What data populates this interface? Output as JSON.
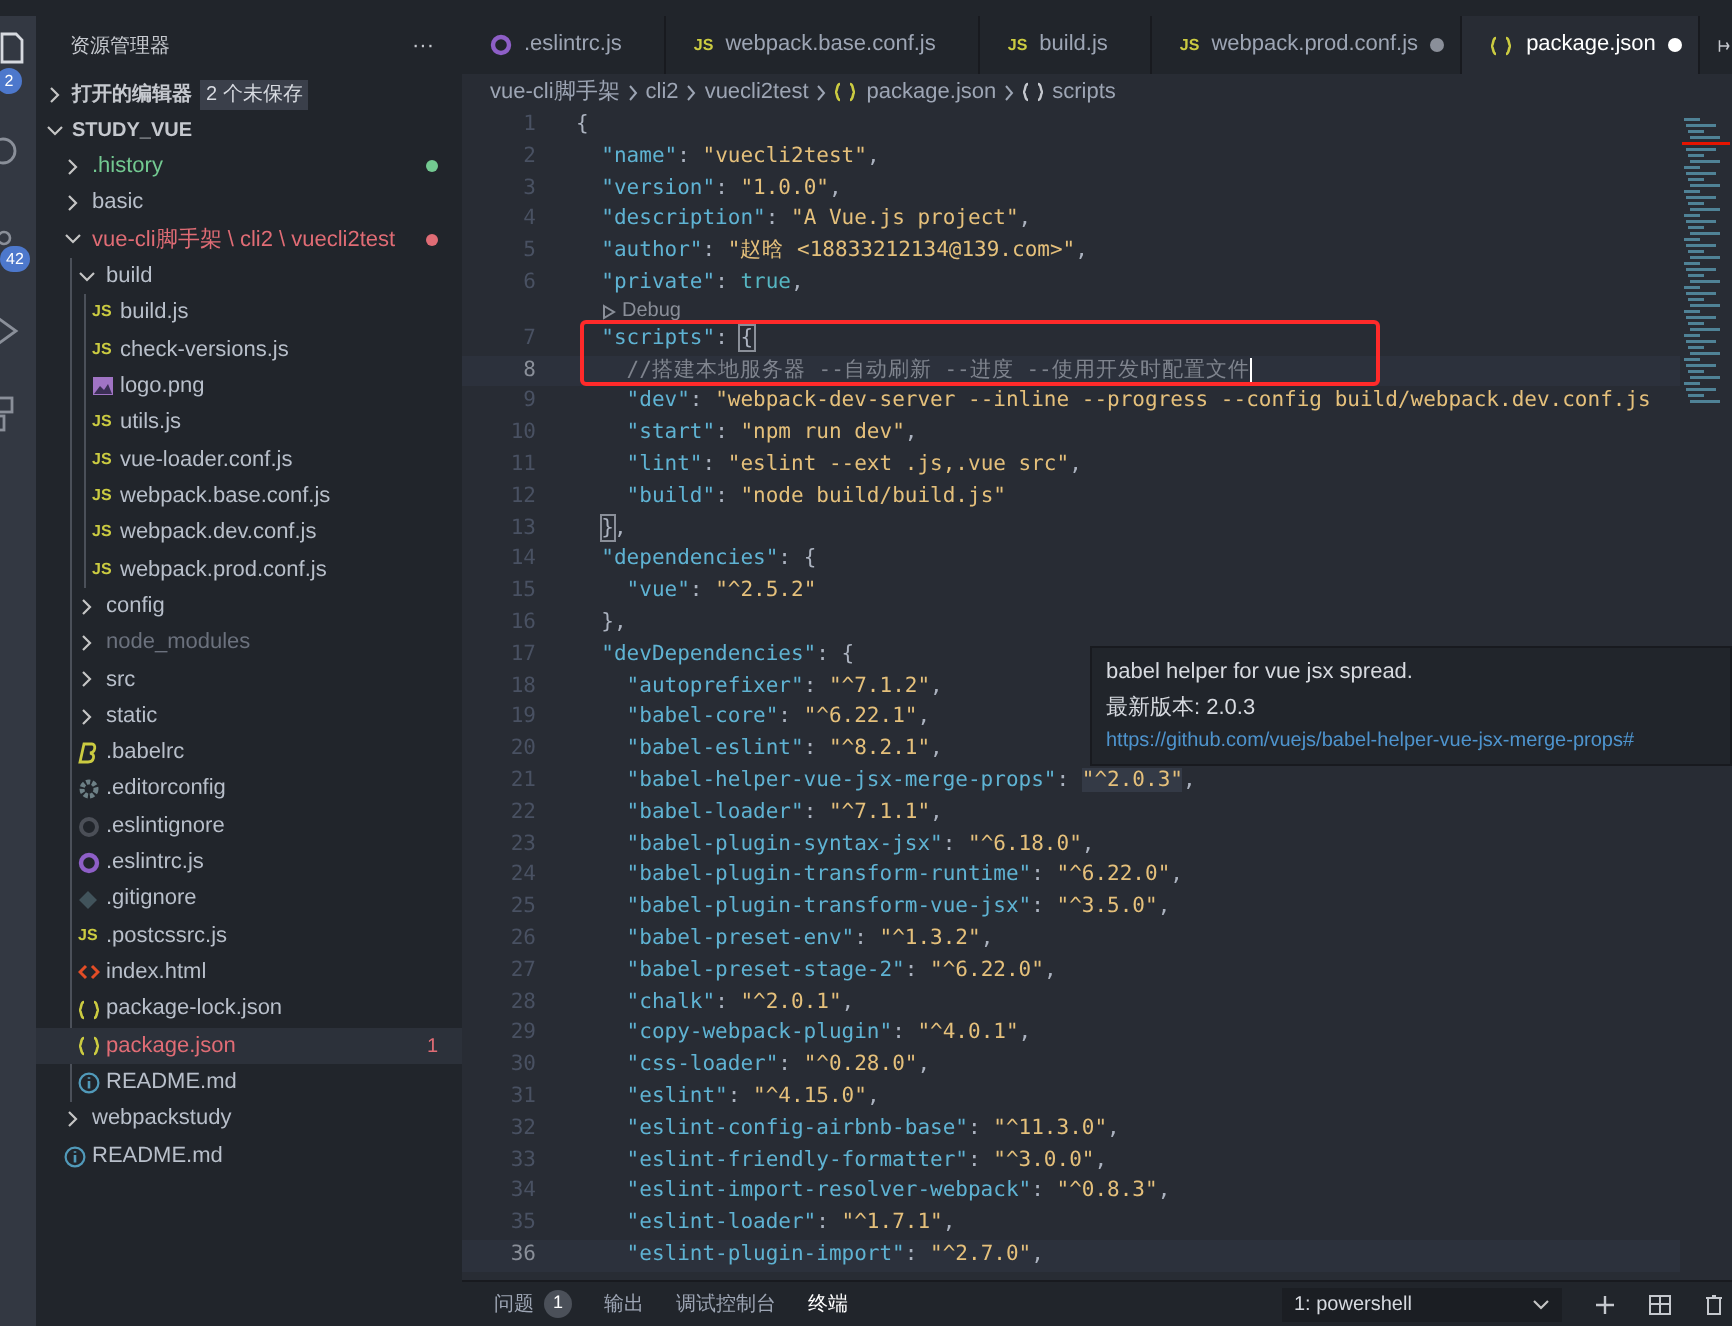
{
  "activity_bar": {
    "badges": [
      "2",
      "42"
    ]
  },
  "sidebar": {
    "title": "资源管理器",
    "more": "···",
    "open_editors": {
      "label": "打开的编辑器",
      "badge": "2 个未保存",
      "expanded": false
    },
    "workspace": {
      "label": "STUDY_VUE",
      "expanded": true,
      "items": [
        {
          "name": ".history",
          "kind": "folder",
          "expanded": false,
          "color": "#73c991",
          "dot": true,
          "selected": false
        },
        {
          "name": "basic",
          "kind": "folder",
          "expanded": false,
          "color": "#b8bfca",
          "dot": false,
          "selected": false
        },
        {
          "name": "vue-cli脚手架 \\ cli2 \\ vuecli2test",
          "kind": "folder",
          "expanded": true,
          "color": "#e06c75",
          "dot": true,
          "selected": false,
          "children": [
            {
              "name": "build",
              "kind": "folder",
              "expanded": true,
              "color": "#b8bfca",
              "dot": false,
              "selected": false,
              "children": [
                {
                  "name": "build.js",
                  "kind": "js",
                  "icon_text": "JS",
                  "color": "#b8bfca",
                  "selected": false
                },
                {
                  "name": "check-versions.js",
                  "kind": "js",
                  "icon_text": "JS",
                  "color": "#b8bfca",
                  "selected": false
                },
                {
                  "name": "logo.png",
                  "kind": "image",
                  "color": "#b8bfca",
                  "selected": false
                },
                {
                  "name": "utils.js",
                  "kind": "js",
                  "icon_text": "JS",
                  "color": "#b8bfca",
                  "selected": false
                },
                {
                  "name": "vue-loader.conf.js",
                  "kind": "js",
                  "icon_text": "JS",
                  "color": "#b8bfca",
                  "selected": false
                },
                {
                  "name": "webpack.base.conf.js",
                  "kind": "js",
                  "icon_text": "JS",
                  "color": "#b8bfca",
                  "selected": false
                },
                {
                  "name": "webpack.dev.conf.js",
                  "kind": "js",
                  "icon_text": "JS",
                  "color": "#b8bfca",
                  "selected": false
                },
                {
                  "name": "webpack.prod.conf.js",
                  "kind": "js",
                  "icon_text": "JS",
                  "color": "#b8bfca",
                  "selected": false
                }
              ]
            },
            {
              "name": "config",
              "kind": "folder",
              "expanded": false,
              "color": "#b8bfca",
              "dot": false,
              "selected": false
            },
            {
              "name": "node_modules",
              "kind": "folder",
              "expanded": false,
              "color": "#6b717d",
              "dot": false,
              "selected": false
            },
            {
              "name": "src",
              "kind": "folder",
              "expanded": false,
              "color": "#b8bfca",
              "dot": false,
              "selected": false
            },
            {
              "name": "static",
              "kind": "folder",
              "expanded": false,
              "color": "#b8bfca",
              "dot": false,
              "selected": false
            },
            {
              "name": ".babelrc",
              "kind": "babel",
              "color": "#b8bfca",
              "selected": false
            },
            {
              "name": ".editorconfig",
              "kind": "config",
              "color": "#b8bfca",
              "selected": false
            },
            {
              "name": ".eslintignore",
              "kind": "eslintignore",
              "color": "#b8bfca",
              "selected": false
            },
            {
              "name": ".eslintrc.js",
              "kind": "eslint",
              "color": "#b8bfca",
              "selected": false
            },
            {
              "name": ".gitignore",
              "kind": "git",
              "color": "#b8bfca",
              "selected": false
            },
            {
              "name": ".postcssrc.js",
              "kind": "js",
              "icon_text": "JS",
              "color": "#b8bfca",
              "selected": false
            },
            {
              "name": "index.html",
              "kind": "html",
              "color": "#b8bfca",
              "selected": false
            },
            {
              "name": "package-lock.json",
              "kind": "json",
              "color": "#b8bfca",
              "selected": false
            },
            {
              "name": "package.json",
              "kind": "json",
              "color": "#e06c75",
              "problems": "1",
              "selected": true
            },
            {
              "name": "README.md",
              "kind": "info",
              "color": "#b8bfca",
              "selected": false
            }
          ]
        },
        {
          "name": "webpackstudy",
          "kind": "folder",
          "expanded": false,
          "color": "#b8bfca",
          "dot": false,
          "selected": false
        },
        {
          "name": "README.md",
          "kind": "info",
          "color": "#b8bfca",
          "selected": false
        }
      ]
    }
  },
  "tabs": [
    {
      "label": ".eslintrc.js",
      "kind": "eslint",
      "dirty": false,
      "selected": false
    },
    {
      "label": "webpack.base.conf.js",
      "kind": "js",
      "icon_text": "JS",
      "dirty": false,
      "selected": false
    },
    {
      "label": "build.js",
      "kind": "js",
      "icon_text": "JS",
      "dirty": false,
      "selected": false
    },
    {
      "label": "webpack.prod.conf.js",
      "kind": "js",
      "icon_text": "JS",
      "dirty": true,
      "selected": false
    },
    {
      "label": "package.json",
      "kind": "json",
      "dirty": true,
      "selected": true
    }
  ],
  "breadcrumb": [
    {
      "label": "vue-cli脚手架",
      "kind": "folder"
    },
    {
      "label": "cli2",
      "kind": "folder"
    },
    {
      "label": "vuecli2test",
      "kind": "folder"
    },
    {
      "label": "package.json",
      "kind": "json"
    },
    {
      "label": "scripts",
      "kind": "object"
    }
  ],
  "code_lines": [
    {
      "n": "1",
      "hl": false,
      "t": [
        {
          "kind": "punct",
          "text": "{"
        }
      ]
    },
    {
      "n": "2",
      "hl": false,
      "t": [
        {
          "kind": "key",
          "text": "  \"name\""
        },
        {
          "kind": "punct",
          "text": ": "
        },
        {
          "kind": "string",
          "text": "\"vuecli2test\""
        },
        {
          "kind": "punct",
          "text": ","
        }
      ]
    },
    {
      "n": "3",
      "hl": false,
      "t": [
        {
          "kind": "key",
          "text": "  \"version\""
        },
        {
          "kind": "punct",
          "text": ": "
        },
        {
          "kind": "string",
          "text": "\"1.0.0\""
        },
        {
          "kind": "punct",
          "text": ","
        }
      ]
    },
    {
      "n": "4",
      "hl": false,
      "t": [
        {
          "kind": "key",
          "text": "  \"description\""
        },
        {
          "kind": "punct",
          "text": ": "
        },
        {
          "kind": "string",
          "text": "\"A Vue.js project\""
        },
        {
          "kind": "punct",
          "text": ","
        }
      ]
    },
    {
      "n": "5",
      "hl": false,
      "t": [
        {
          "kind": "key",
          "text": "  \"author\""
        },
        {
          "kind": "punct",
          "text": ": "
        },
        {
          "kind": "string",
          "text": "\"赵晗 <18833212134@139.com>\""
        },
        {
          "kind": "punct",
          "text": ","
        }
      ]
    },
    {
      "n": "6",
      "hl": false,
      "t": [
        {
          "kind": "key",
          "text": "  \"private\""
        },
        {
          "kind": "punct",
          "text": ": "
        },
        {
          "kind": "bool",
          "text": "true"
        },
        {
          "kind": "punct",
          "text": ","
        }
      ]
    },
    {
      "n": "7",
      "hl": false,
      "lens": "Debug",
      "t": [
        {
          "kind": "key",
          "text": "  \"scripts\""
        },
        {
          "kind": "punct",
          "text": ": "
        },
        {
          "kind": "match",
          "text": "{"
        }
      ]
    },
    {
      "n": "8",
      "hl": true,
      "t": [
        {
          "kind": "comment",
          "text": "    //搭建本地服务器 --自动刷新 --进度 --使用开发时配置文件"
        }
      ]
    },
    {
      "n": "9",
      "hl": false,
      "t": [
        {
          "kind": "key",
          "text": "    \"dev\""
        },
        {
          "kind": "punct",
          "text": ": "
        },
        {
          "kind": "string",
          "text": "\"webpack-dev-server --inline --progress --config build/webpack.dev.conf.js"
        }
      ]
    },
    {
      "n": "10",
      "hl": false,
      "t": [
        {
          "kind": "key",
          "text": "    \"start\""
        },
        {
          "kind": "punct",
          "text": ": "
        },
        {
          "kind": "string",
          "text": "\"npm run dev\""
        },
        {
          "kind": "punct",
          "text": ","
        }
      ]
    },
    {
      "n": "11",
      "hl": false,
      "t": [
        {
          "kind": "key",
          "text": "    \"lint\""
        },
        {
          "kind": "punct",
          "text": ": "
        },
        {
          "kind": "string",
          "text": "\"eslint --ext .js,.vue src\""
        },
        {
          "kind": "punct",
          "text": ","
        }
      ]
    },
    {
      "n": "12",
      "hl": false,
      "t": [
        {
          "kind": "key",
          "text": "    \"build\""
        },
        {
          "kind": "punct",
          "text": ": "
        },
        {
          "kind": "string",
          "text": "\"node build/build.js\""
        }
      ]
    },
    {
      "n": "13",
      "hl": false,
      "t": [
        {
          "kind": "match",
          "text": "  }"
        },
        {
          "kind": "punct",
          "text": ","
        }
      ]
    },
    {
      "n": "14",
      "hl": false,
      "t": [
        {
          "kind": "key",
          "text": "  \"dependencies\""
        },
        {
          "kind": "punct",
          "text": ": {"
        }
      ]
    },
    {
      "n": "15",
      "hl": false,
      "t": [
        {
          "kind": "key",
          "text": "    \"vue\""
        },
        {
          "kind": "punct",
          "text": ": "
        },
        {
          "kind": "string",
          "text": "\"^2.5.2\""
        }
      ]
    },
    {
      "n": "16",
      "hl": false,
      "t": [
        {
          "kind": "punct",
          "text": "  },"
        }
      ]
    },
    {
      "n": "17",
      "hl": false,
      "t": [
        {
          "kind": "key",
          "text": "  \"devDependencies\""
        },
        {
          "kind": "punct",
          "text": ": {"
        }
      ]
    },
    {
      "n": "18",
      "hl": false,
      "t": [
        {
          "kind": "key",
          "text": "    \"autoprefixer\""
        },
        {
          "kind": "punct",
          "text": ": "
        },
        {
          "kind": "string",
          "text": "\"^7.1.2\""
        },
        {
          "kind": "punct",
          "text": ","
        }
      ]
    },
    {
      "n": "19",
      "hl": false,
      "t": [
        {
          "kind": "key",
          "text": "    \"babel-core\""
        },
        {
          "kind": "punct",
          "text": ": "
        },
        {
          "kind": "string",
          "text": "\"^6.22.1\""
        },
        {
          "kind": "punct",
          "text": ","
        }
      ]
    },
    {
      "n": "20",
      "hl": false,
      "t": [
        {
          "kind": "key",
          "text": "    \"babel-eslint\""
        },
        {
          "kind": "punct",
          "text": ": "
        },
        {
          "kind": "string",
          "text": "\"^8.2.1\""
        },
        {
          "kind": "punct",
          "text": ","
        }
      ]
    },
    {
      "n": "21",
      "hl": false,
      "t": [
        {
          "kind": "key",
          "text": "    \"babel-helper-vue-jsx-merge-props\""
        },
        {
          "kind": "punct",
          "text": ": "
        },
        {
          "kind": "hovered",
          "text": "\"^2.0.3\""
        },
        {
          "kind": "punct",
          "text": ","
        }
      ]
    },
    {
      "n": "22",
      "hl": false,
      "t": [
        {
          "kind": "key",
          "text": "    \"babel-loader\""
        },
        {
          "kind": "punct",
          "text": ": "
        },
        {
          "kind": "string",
          "text": "\"^7.1.1\""
        },
        {
          "kind": "punct",
          "text": ","
        }
      ]
    },
    {
      "n": "23",
      "hl": false,
      "t": [
        {
          "kind": "key",
          "text": "    \"babel-plugin-syntax-jsx\""
        },
        {
          "kind": "punct",
          "text": ": "
        },
        {
          "kind": "string",
          "text": "\"^6.18.0\""
        },
        {
          "kind": "punct",
          "text": ","
        }
      ]
    },
    {
      "n": "24",
      "hl": false,
      "t": [
        {
          "kind": "key",
          "text": "    \"babel-plugin-transform-runtime\""
        },
        {
          "kind": "punct",
          "text": ": "
        },
        {
          "kind": "string",
          "text": "\"^6.22.0\""
        },
        {
          "kind": "punct",
          "text": ","
        }
      ]
    },
    {
      "n": "25",
      "hl": false,
      "t": [
        {
          "kind": "key",
          "text": "    \"babel-plugin-transform-vue-jsx\""
        },
        {
          "kind": "punct",
          "text": ": "
        },
        {
          "kind": "string",
          "text": "\"^3.5.0\""
        },
        {
          "kind": "punct",
          "text": ","
        }
      ]
    },
    {
      "n": "26",
      "hl": false,
      "t": [
        {
          "kind": "key",
          "text": "    \"babel-preset-env\""
        },
        {
          "kind": "punct",
          "text": ": "
        },
        {
          "kind": "string",
          "text": "\"^1.3.2\""
        },
        {
          "kind": "punct",
          "text": ","
        }
      ]
    },
    {
      "n": "27",
      "hl": false,
      "t": [
        {
          "kind": "key",
          "text": "    \"babel-preset-stage-2\""
        },
        {
          "kind": "punct",
          "text": ": "
        },
        {
          "kind": "string",
          "text": "\"^6.22.0\""
        },
        {
          "kind": "punct",
          "text": ","
        }
      ]
    },
    {
      "n": "28",
      "hl": false,
      "t": [
        {
          "kind": "key",
          "text": "    \"chalk\""
        },
        {
          "kind": "punct",
          "text": ": "
        },
        {
          "kind": "string",
          "text": "\"^2.0.1\""
        },
        {
          "kind": "punct",
          "text": ","
        }
      ]
    },
    {
      "n": "29",
      "hl": false,
      "t": [
        {
          "kind": "key",
          "text": "    \"copy-webpack-plugin\""
        },
        {
          "kind": "punct",
          "text": ": "
        },
        {
          "kind": "string",
          "text": "\"^4.0.1\""
        },
        {
          "kind": "punct",
          "text": ","
        }
      ]
    },
    {
      "n": "30",
      "hl": false,
      "t": [
        {
          "kind": "key",
          "text": "    \"css-loader\""
        },
        {
          "kind": "punct",
          "text": ": "
        },
        {
          "kind": "string",
          "text": "\"^0.28.0\""
        },
        {
          "kind": "punct",
          "text": ","
        }
      ]
    },
    {
      "n": "31",
      "hl": false,
      "t": [
        {
          "kind": "key",
          "text": "    \"eslint\""
        },
        {
          "kind": "punct",
          "text": ": "
        },
        {
          "kind": "string",
          "text": "\"^4.15.0\""
        },
        {
          "kind": "punct",
          "text": ","
        }
      ]
    },
    {
      "n": "32",
      "hl": false,
      "t": [
        {
          "kind": "key",
          "text": "    \"eslint-config-airbnb-base\""
        },
        {
          "kind": "punct",
          "text": ": "
        },
        {
          "kind": "string",
          "text": "\"^11.3.0\""
        },
        {
          "kind": "punct",
          "text": ","
        }
      ]
    },
    {
      "n": "33",
      "hl": false,
      "t": [
        {
          "kind": "key",
          "text": "    \"eslint-friendly-formatter\""
        },
        {
          "kind": "punct",
          "text": ": "
        },
        {
          "kind": "string",
          "text": "\"^3.0.0\""
        },
        {
          "kind": "punct",
          "text": ","
        }
      ]
    },
    {
      "n": "34",
      "hl": false,
      "t": [
        {
          "kind": "key",
          "text": "    \"eslint-import-resolver-webpack\""
        },
        {
          "kind": "punct",
          "text": ": "
        },
        {
          "kind": "string",
          "text": "\"^0.8.3\""
        },
        {
          "kind": "punct",
          "text": ","
        }
      ]
    },
    {
      "n": "35",
      "hl": false,
      "t": [
        {
          "kind": "key",
          "text": "    \"eslint-loader\""
        },
        {
          "kind": "punct",
          "text": ": "
        },
        {
          "kind": "string",
          "text": "\"^1.7.1\""
        },
        {
          "kind": "punct",
          "text": ","
        }
      ]
    },
    {
      "n": "36",
      "hl": true,
      "t": [
        {
          "kind": "key",
          "text": "    \"eslint-plugin-import\""
        },
        {
          "kind": "punct",
          "text": ": "
        },
        {
          "kind": "string",
          "text": "\"^2.7.0\""
        },
        {
          "kind": "punct",
          "text": ","
        }
      ]
    }
  ],
  "hover": {
    "description": "babel helper for vue jsx spread.",
    "version": "最新版本: 2.0.3",
    "link": "https://github.com/vuejs/babel-helper-vue-jsx-merge-props#"
  },
  "panel": {
    "tabs": [
      {
        "label": "问题",
        "badge": "1",
        "selected": false
      },
      {
        "label": "输出",
        "selected": false
      },
      {
        "label": "调试控制台",
        "selected": false
      },
      {
        "label": "终端",
        "selected": true
      }
    ],
    "terminal": "1: powershell"
  }
}
